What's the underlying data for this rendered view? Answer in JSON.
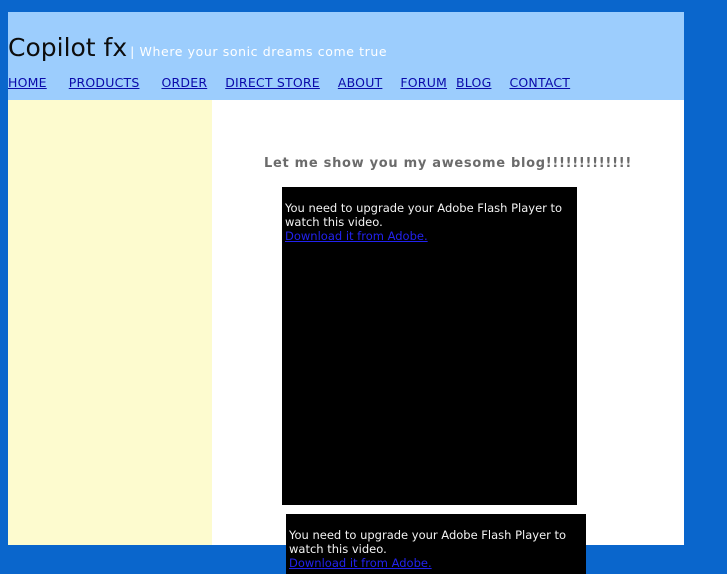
{
  "colors": {
    "page_background": "#0a66cc",
    "header_background": "#9ccdfd",
    "sidebar_background": "#fdfbcf",
    "content_background": "#ffffff",
    "title_text": "#0d0d0d",
    "tagline_text": "#ffffff",
    "nav_link": "#0a0aaa",
    "heading_text": "#6b6b6b",
    "flash_stage": "#000000",
    "flash_text": "#f2f2f2",
    "flash_link": "#2222ee"
  },
  "header": {
    "site_title": "Copilot fx",
    "tagline": "| Where your sonic dreams come true"
  },
  "nav": {
    "items": [
      {
        "label": "HOME"
      },
      {
        "label": "PRODUCTS"
      },
      {
        "label": "ORDER"
      },
      {
        "label": "DIRECT STORE"
      },
      {
        "label": "ABOUT"
      },
      {
        "label": "FORUM"
      },
      {
        "label": "BLOG"
      },
      {
        "label": "CONTACT"
      }
    ]
  },
  "main": {
    "heading": "Let me show you my awesome blog!!!!!!!!!!!!!",
    "flash_players": [
      {
        "message_line_1": "You need to upgrade your Adobe Flash Player to",
        "message_line_2": "watch this video.",
        "link_label": "Download it from Adobe."
      },
      {
        "message_line_1": "You need to upgrade your Adobe Flash Player to",
        "message_line_2": "watch this video.",
        "link_label": "Download it from Adobe."
      }
    ]
  },
  "sidebar": {
    "content": ""
  }
}
